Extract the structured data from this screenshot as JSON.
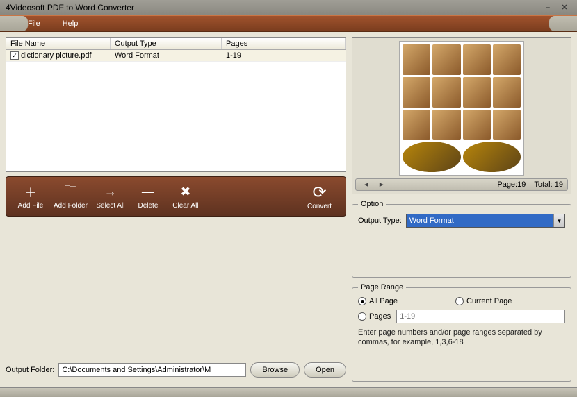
{
  "window": {
    "title": "4Videosoft PDF to Word Converter"
  },
  "menu": {
    "file": "File",
    "help": "Help"
  },
  "table": {
    "headers": {
      "name": "File Name",
      "type": "Output Type",
      "pages": "Pages"
    },
    "rows": [
      {
        "checked": true,
        "name": "dictionary picture.pdf",
        "type": "Word Format",
        "pages": "1-19"
      }
    ]
  },
  "toolbar": {
    "add_file": "Add File",
    "add_folder": "Add Folder",
    "select_all": "Select All",
    "delete": "Delete",
    "clear_all": "Clear All",
    "convert": "Convert"
  },
  "output": {
    "label": "Output Folder:",
    "path": "C:\\Documents and Settings\\Administrator\\M",
    "browse": "Browse",
    "open": "Open"
  },
  "preview": {
    "page_label": "Page:",
    "page_value": "19",
    "total_label": "Total:",
    "total_value": "19"
  },
  "option": {
    "legend": "Option",
    "output_type_label": "Output Type:",
    "output_type_value": "Word Format"
  },
  "page_range": {
    "legend": "Page Range",
    "all": "All Page",
    "current": "Current Page",
    "pages": "Pages",
    "pages_placeholder": "1-19",
    "hint": "Enter page numbers and/or page ranges separated by commas, for example, 1,3,6-18"
  }
}
